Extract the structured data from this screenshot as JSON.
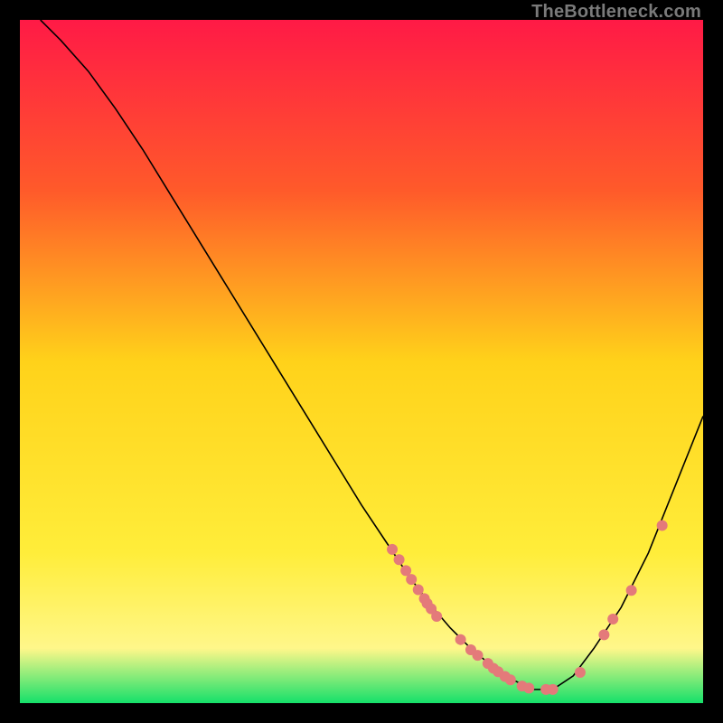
{
  "watermark": "TheBottleneck.com",
  "chart_data": {
    "type": "line",
    "title": "",
    "xlabel": "",
    "ylabel": "",
    "xlim": [
      0,
      100
    ],
    "ylim": [
      0,
      100
    ],
    "grid": false,
    "legend": false,
    "gradient_stops": [
      {
        "offset": 0,
        "color": "#ff1a46"
      },
      {
        "offset": 25,
        "color": "#ff5a2a"
      },
      {
        "offset": 50,
        "color": "#ffd21a"
      },
      {
        "offset": 78,
        "color": "#ffed3a"
      },
      {
        "offset": 92,
        "color": "#fff78a"
      },
      {
        "offset": 100,
        "color": "#15e06a"
      }
    ],
    "series": [
      {
        "name": "bottleneck-curve",
        "x": [
          3,
          6,
          10,
          14,
          18,
          22,
          26,
          30,
          34,
          38,
          42,
          46,
          50,
          54,
          57,
          60,
          63,
          66,
          69,
          72,
          75,
          78,
          81,
          84,
          88,
          92,
          96,
          100
        ],
        "y": [
          100,
          97,
          92.5,
          87,
          81,
          74.5,
          68,
          61.5,
          55,
          48.5,
          42,
          35.5,
          29,
          23,
          18.5,
          14.5,
          11,
          8,
          5.5,
          3.5,
          2,
          2,
          4,
          8,
          14,
          22,
          32,
          42
        ],
        "color": "#000000",
        "linewidth": 1.6
      }
    ],
    "markers": {
      "color": "#e47a7a",
      "radius": 6,
      "points": [
        {
          "x": 54.5,
          "y": 22.5
        },
        {
          "x": 55.5,
          "y": 21.0
        },
        {
          "x": 56.5,
          "y": 19.4
        },
        {
          "x": 57.3,
          "y": 18.1
        },
        {
          "x": 58.3,
          "y": 16.6
        },
        {
          "x": 59.2,
          "y": 15.3
        },
        {
          "x": 59.6,
          "y": 14.6
        },
        {
          "x": 60.2,
          "y": 13.8
        },
        {
          "x": 61.0,
          "y": 12.7
        },
        {
          "x": 64.5,
          "y": 9.3
        },
        {
          "x": 66.0,
          "y": 7.8
        },
        {
          "x": 67.0,
          "y": 7.0
        },
        {
          "x": 68.5,
          "y": 5.8
        },
        {
          "x": 69.3,
          "y": 5.1
        },
        {
          "x": 70.0,
          "y": 4.6
        },
        {
          "x": 71.0,
          "y": 3.9
        },
        {
          "x": 71.8,
          "y": 3.4
        },
        {
          "x": 73.5,
          "y": 2.5
        },
        {
          "x": 74.5,
          "y": 2.2
        },
        {
          "x": 77.0,
          "y": 2.0
        },
        {
          "x": 78.0,
          "y": 2.0
        },
        {
          "x": 82.0,
          "y": 4.5
        },
        {
          "x": 85.5,
          "y": 10.0
        },
        {
          "x": 86.8,
          "y": 12.3
        },
        {
          "x": 89.5,
          "y": 16.5
        },
        {
          "x": 94.0,
          "y": 26.0
        }
      ]
    }
  }
}
